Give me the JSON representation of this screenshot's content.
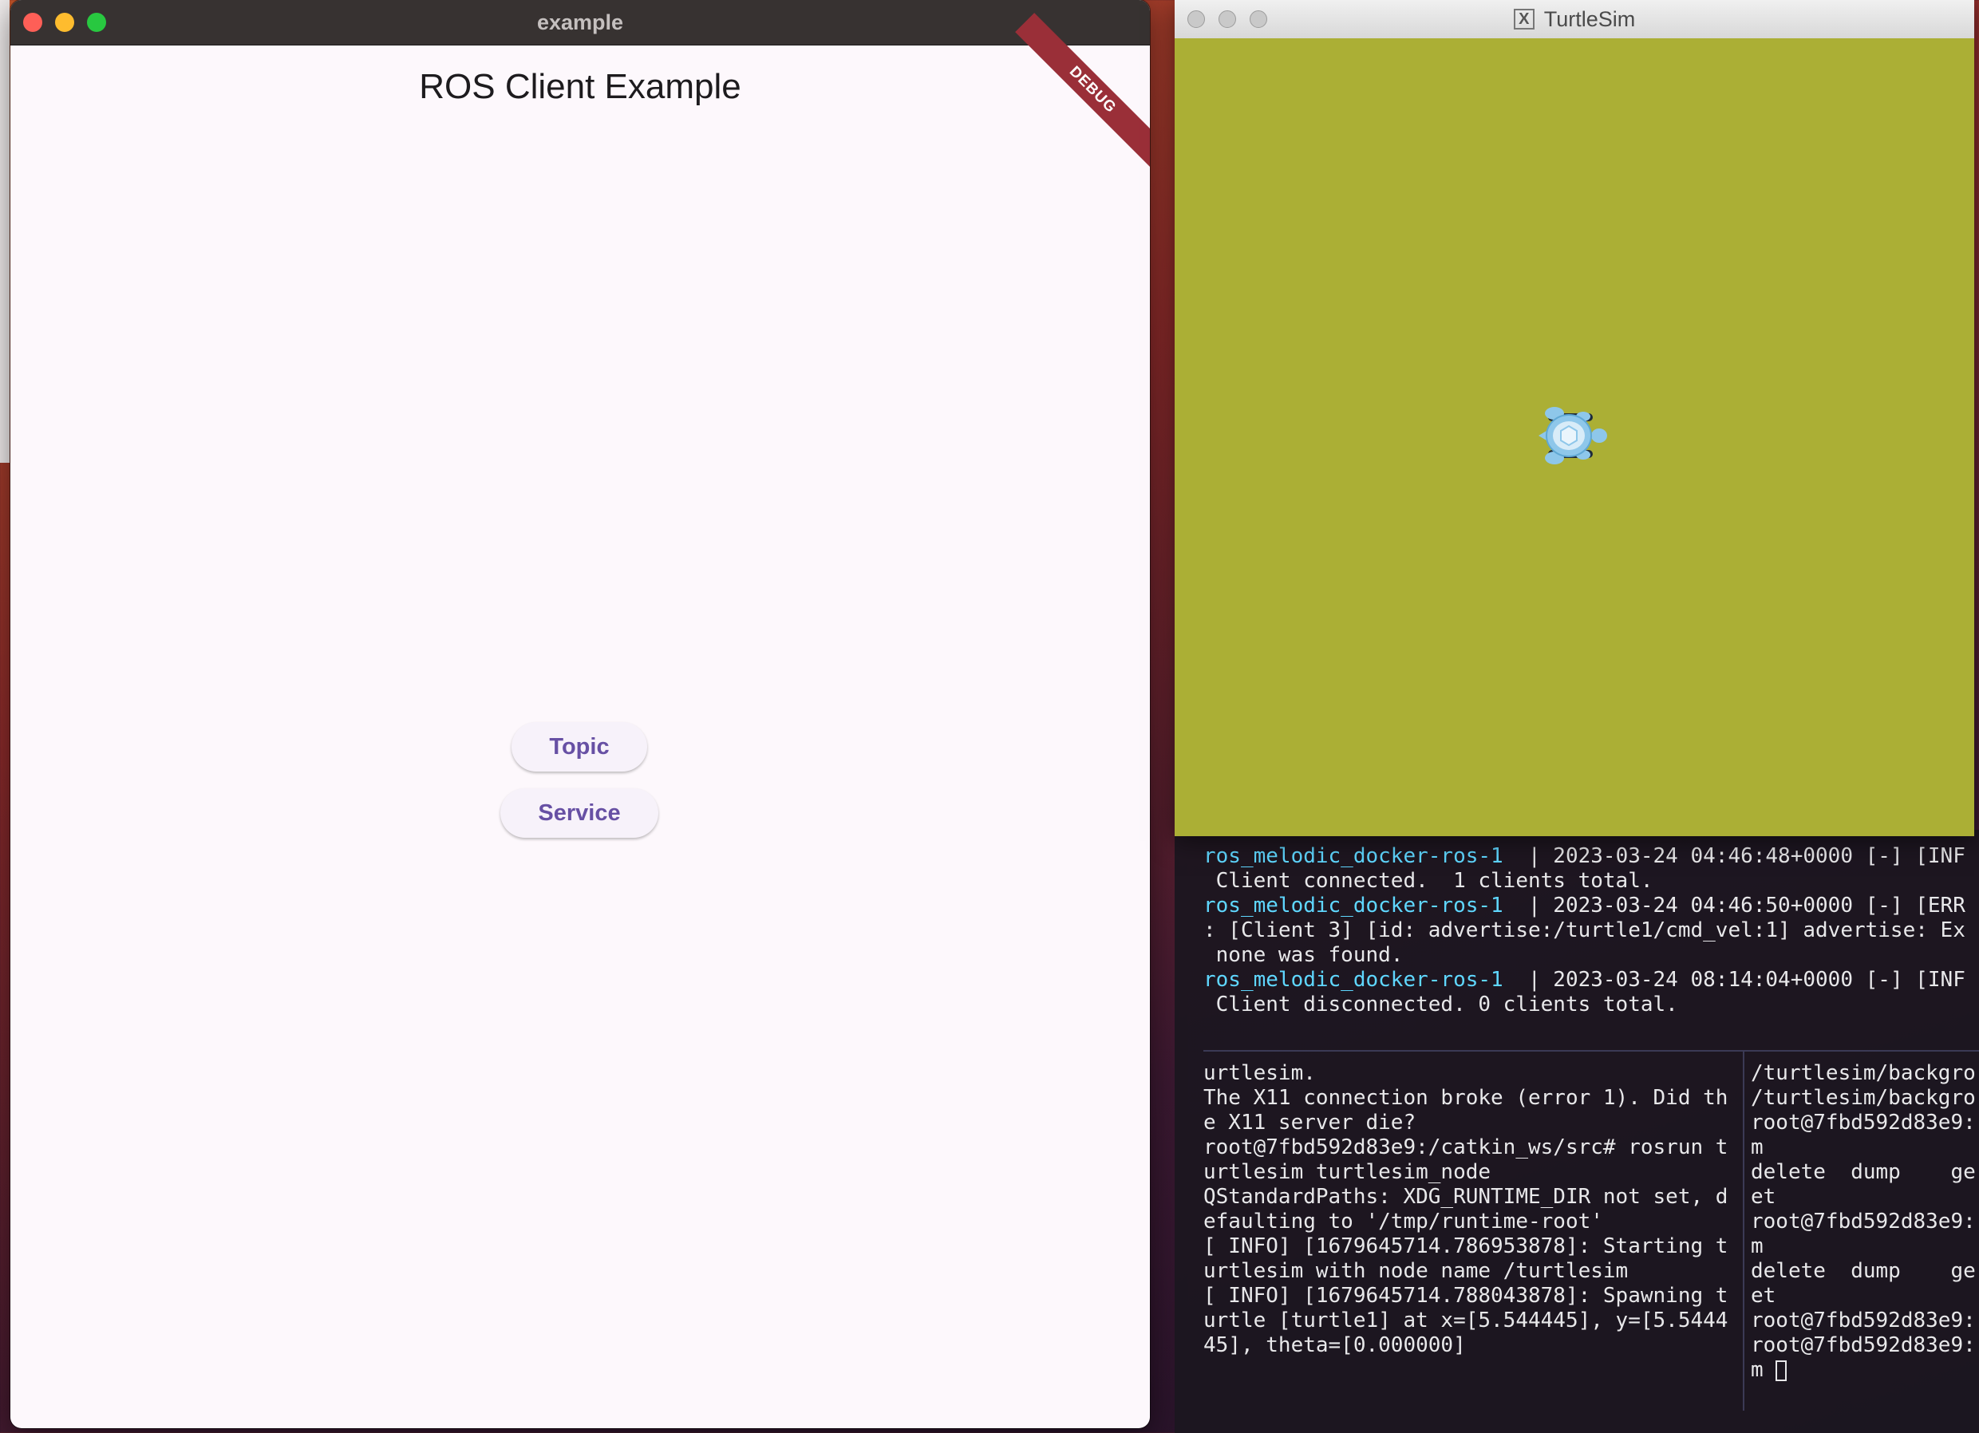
{
  "example_window": {
    "title": "example",
    "app_title": "ROS Client Example",
    "debug_banner": "DEBUG",
    "buttons": {
      "topic": "Topic",
      "service": "Service"
    }
  },
  "turtlesim_window": {
    "title": "TurtleSim",
    "background_color": "#abaf35"
  },
  "terminal": {
    "top_log": [
      {
        "prefix": "ros_melodic_docker-ros-1",
        "text": "  | 2023-03-24 04:46:48+0000 [-] [INF"
      },
      {
        "prefix": "",
        "text": " Client connected.  1 clients total."
      },
      {
        "prefix": "ros_melodic_docker-ros-1",
        "text": "  | 2023-03-24 04:46:50+0000 [-] [ERR"
      },
      {
        "prefix": "",
        "text": ": [Client 3] [id: advertise:/turtle1/cmd_vel:1] advertise: Ex"
      },
      {
        "prefix": "",
        "text": " none was found."
      },
      {
        "prefix": "ros_melodic_docker-ros-1",
        "text": "  | 2023-03-24 08:14:04+0000 [-] [INF"
      },
      {
        "prefix": "",
        "text": " Client disconnected. 0 clients total."
      }
    ],
    "left_pane": [
      "urtlesim.",
      "The X11 connection broke (error 1). Did th",
      "e X11 server die?",
      "root@7fbd592d83e9:/catkin_ws/src# rosrun t",
      "urtlesim turtlesim_node",
      "QStandardPaths: XDG_RUNTIME_DIR not set, d",
      "efaulting to '/tmp/runtime-root'",
      "[ INFO] [1679645714.786953878]: Starting t",
      "urtlesim with node name /turtlesim",
      "[ INFO] [1679645714.788043878]: Spawning t",
      "urtle [turtle1] at x=[5.544445], y=[5.5444",
      "45], theta=[0.000000]"
    ],
    "right_pane": [
      "/turtlesim/backgro",
      "/turtlesim/backgro",
      "root@7fbd592d83e9:",
      "m",
      "delete  dump    ge",
      "et",
      "root@7fbd592d83e9:",
      "m",
      "delete  dump    ge",
      "et",
      "root@7fbd592d83e9:",
      "root@7fbd592d83e9:",
      "m "
    ]
  }
}
